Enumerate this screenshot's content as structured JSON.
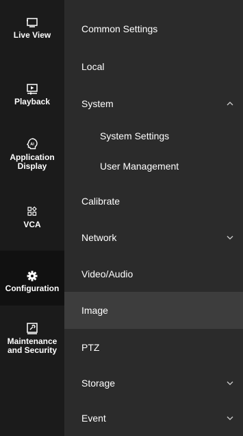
{
  "rail": {
    "items": [
      {
        "label": "Live View",
        "icon": "monitor-icon"
      },
      {
        "label": "Playback",
        "icon": "playback-icon"
      },
      {
        "label_line1": "Application",
        "label_line2": "Display",
        "icon": "ai-icon"
      },
      {
        "label": "VCA",
        "icon": "vca-grid-icon"
      },
      {
        "label": "Configuration",
        "icon": "gear-icon",
        "active": true
      },
      {
        "label_line1": "Maintenance",
        "label_line2": "and Security",
        "icon": "maintenance-icon"
      }
    ]
  },
  "menu": {
    "items": [
      {
        "label": "Common Settings"
      },
      {
        "label": "Local"
      },
      {
        "label": "System",
        "expanded": true
      },
      {
        "label": "System Settings"
      },
      {
        "label": "User Management"
      },
      {
        "label": "Calibrate"
      },
      {
        "label": "Network",
        "expanded": false
      },
      {
        "label": "Video/Audio"
      },
      {
        "label": "Image",
        "selected": true
      },
      {
        "label": "PTZ"
      },
      {
        "label": "Storage",
        "expanded": false
      },
      {
        "label": "Event",
        "expanded": false
      }
    ]
  },
  "colors": {
    "rail_bg": "#1b1b1b",
    "rail_active_bg": "#111111",
    "menu_bg": "#2b2b2b",
    "menu_highlight_bg": "#3d3d3d",
    "text": "#ffffff"
  }
}
